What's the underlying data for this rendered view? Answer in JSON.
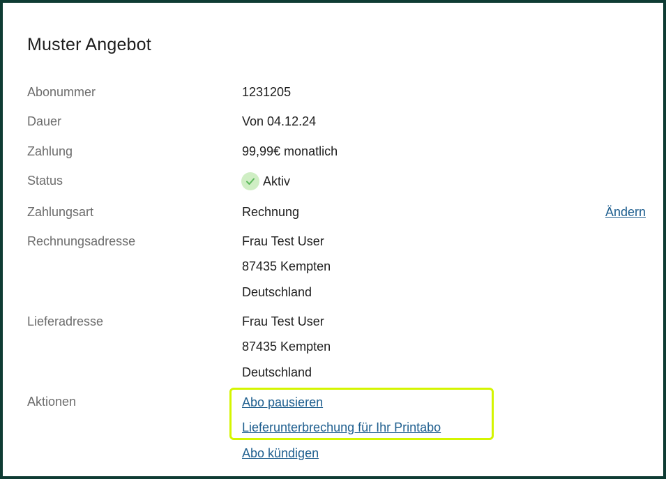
{
  "title": "Muster Angebot",
  "rows": {
    "abonummer": {
      "label": "Abonummer",
      "value": "1231205"
    },
    "dauer": {
      "label": "Dauer",
      "value": "Von 04.12.24"
    },
    "zahlung": {
      "label": "Zahlung",
      "value": "99,99€ monatlich"
    },
    "status": {
      "label": "Status",
      "value": "Aktiv",
      "icon": "check-icon",
      "icon_color": "#5cb85c"
    },
    "zahlungsart": {
      "label": "Zahlungsart",
      "value": "Rechnung",
      "action": "Ändern"
    },
    "rechnungsadresse": {
      "label": "Rechnungsadresse",
      "lines": [
        "Frau Test User",
        "87435 Kempten",
        "Deutschland"
      ]
    },
    "lieferadresse": {
      "label": "Lieferadresse",
      "lines": [
        "Frau Test User",
        "87435 Kempten",
        "Deutschland"
      ]
    },
    "aktionen": {
      "label": "Aktionen",
      "links": [
        "Abo pausieren",
        "Lieferunterbrechung für Ihr Printabo",
        "Abo kündigen"
      ]
    }
  },
  "colors": {
    "link": "#1f5f8f",
    "highlight": "#d4f500",
    "frame": "#0e3b33"
  }
}
